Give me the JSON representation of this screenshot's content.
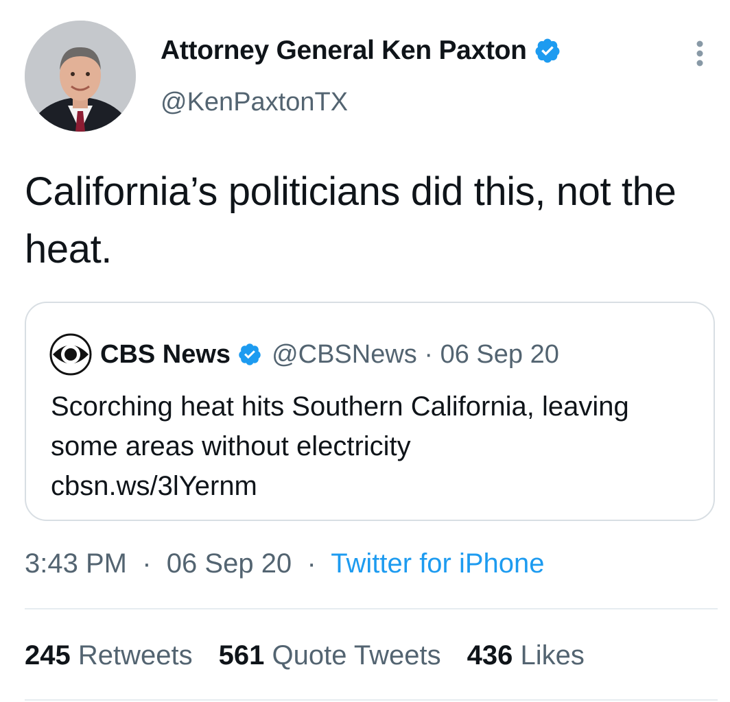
{
  "author": {
    "name": "Attorney General Ken Paxton",
    "handle": "@KenPaxtonTX",
    "avatar_icon": "profile-photo",
    "verified_icon": "verified-badge-icon"
  },
  "tweet": {
    "text": "California’s politicians did this, not the heat."
  },
  "quoted_tweet": {
    "author_name": "CBS News",
    "author_handle": "@CBSNews",
    "separator": "·",
    "date": "06 Sep 20",
    "text": "Scorching heat hits Southern California, leaving some areas without electricity",
    "link": "cbsn.ws/3lYernm"
  },
  "meta": {
    "time": "3:43 PM",
    "separator": "·",
    "date": "06 Sep 20",
    "source": "Twitter for iPhone"
  },
  "stats": [
    {
      "count": "245",
      "label": "Retweets"
    },
    {
      "count": "561",
      "label": "Quote Tweets"
    },
    {
      "count": "436",
      "label": "Likes"
    }
  ],
  "colors": {
    "link_blue": "#1d9bf0",
    "verified_blue": "#1d9bf0",
    "muted_text": "#536471",
    "border": "#d8dee3"
  }
}
